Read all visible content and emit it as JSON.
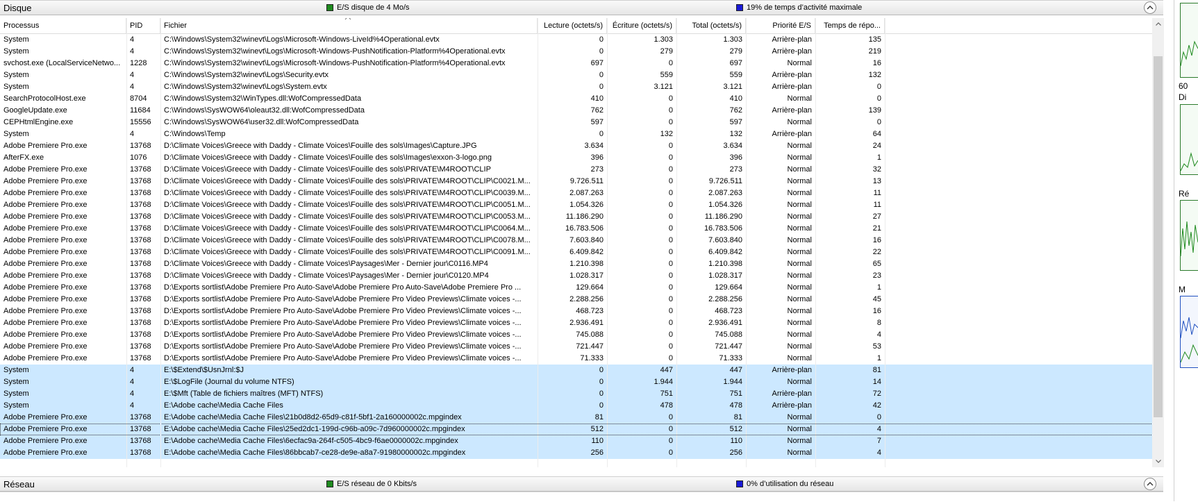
{
  "disk_section": {
    "title": "Disque",
    "stat1": "E/S disque de 4 Mo/s",
    "stat2": "19% de temps d’activité maximale"
  },
  "network_section": {
    "title": "Réseau",
    "stat1": "E/S réseau de 0 Kbits/s",
    "stat2": "0% d’utilisation du réseau"
  },
  "columns": [
    "Processus",
    "PID",
    "Fichier",
    "Lecture (octets/s)",
    "Écriture (octets/s)",
    "Total (octets/s)",
    "Priorité E/S",
    "Temps de répo..."
  ],
  "rows": [
    [
      "System",
      "4",
      "C:\\Windows\\System32\\winevt\\Logs\\Microsoft-Windows-LiveId%4Operational.evtx",
      "0",
      "1.303",
      "1.303",
      "Arrière-plan",
      "135"
    ],
    [
      "System",
      "4",
      "C:\\Windows\\System32\\winevt\\Logs\\Microsoft-Windows-PushNotification-Platform%4Operational.evtx",
      "0",
      "279",
      "279",
      "Arrière-plan",
      "219"
    ],
    [
      "svchost.exe (LocalServiceNetwo...",
      "1228",
      "C:\\Windows\\System32\\winevt\\Logs\\Microsoft-Windows-PushNotification-Platform%4Operational.evtx",
      "697",
      "0",
      "697",
      "Normal",
      "16"
    ],
    [
      "System",
      "4",
      "C:\\Windows\\System32\\winevt\\Logs\\Security.evtx",
      "0",
      "559",
      "559",
      "Arrière-plan",
      "132"
    ],
    [
      "System",
      "4",
      "C:\\Windows\\System32\\winevt\\Logs\\System.evtx",
      "0",
      "3.121",
      "3.121",
      "Arrière-plan",
      "0"
    ],
    [
      "SearchProtocolHost.exe",
      "8704",
      "C:\\Windows\\System32\\WinTypes.dll:WofCompressedData",
      "410",
      "0",
      "410",
      "Normal",
      "0"
    ],
    [
      "GoogleUpdate.exe",
      "11684",
      "C:\\Windows\\SysWOW64\\oleaut32.dll:WofCompressedData",
      "762",
      "0",
      "762",
      "Arrière-plan",
      "139"
    ],
    [
      "CEPHtmlEngine.exe",
      "15556",
      "C:\\Windows\\SysWOW64\\user32.dll:WofCompressedData",
      "597",
      "0",
      "597",
      "Normal",
      "0"
    ],
    [
      "System",
      "4",
      "C:\\Windows\\Temp",
      "0",
      "132",
      "132",
      "Arrière-plan",
      "64"
    ],
    [
      "Adobe Premiere Pro.exe",
      "13768",
      "D:\\Climate Voices\\Greece with Daddy - Climate Voices\\Fouille des sols\\Images\\Capture.JPG",
      "3.634",
      "0",
      "3.634",
      "Normal",
      "24"
    ],
    [
      "AfterFX.exe",
      "1076",
      "D:\\Climate Voices\\Greece with Daddy - Climate Voices\\Fouille des sols\\Images\\exxon-3-logo.png",
      "396",
      "0",
      "396",
      "Normal",
      "1"
    ],
    [
      "Adobe Premiere Pro.exe",
      "13768",
      "D:\\Climate Voices\\Greece with Daddy - Climate Voices\\Fouille des sols\\PRIVATE\\M4ROOT\\CLIP",
      "273",
      "0",
      "273",
      "Normal",
      "32"
    ],
    [
      "Adobe Premiere Pro.exe",
      "13768",
      "D:\\Climate Voices\\Greece with Daddy - Climate Voices\\Fouille des sols\\PRIVATE\\M4ROOT\\CLIP\\C0021.M...",
      "9.726.511",
      "0",
      "9.726.511",
      "Normal",
      "13"
    ],
    [
      "Adobe Premiere Pro.exe",
      "13768",
      "D:\\Climate Voices\\Greece with Daddy - Climate Voices\\Fouille des sols\\PRIVATE\\M4ROOT\\CLIP\\C0039.M...",
      "2.087.263",
      "0",
      "2.087.263",
      "Normal",
      "11"
    ],
    [
      "Adobe Premiere Pro.exe",
      "13768",
      "D:\\Climate Voices\\Greece with Daddy - Climate Voices\\Fouille des sols\\PRIVATE\\M4ROOT\\CLIP\\C0051.M...",
      "1.054.326",
      "0",
      "1.054.326",
      "Normal",
      "11"
    ],
    [
      "Adobe Premiere Pro.exe",
      "13768",
      "D:\\Climate Voices\\Greece with Daddy - Climate Voices\\Fouille des sols\\PRIVATE\\M4ROOT\\CLIP\\C0053.M...",
      "11.186.290",
      "0",
      "11.186.290",
      "Normal",
      "27"
    ],
    [
      "Adobe Premiere Pro.exe",
      "13768",
      "D:\\Climate Voices\\Greece with Daddy - Climate Voices\\Fouille des sols\\PRIVATE\\M4ROOT\\CLIP\\C0064.M...",
      "16.783.506",
      "0",
      "16.783.506",
      "Normal",
      "21"
    ],
    [
      "Adobe Premiere Pro.exe",
      "13768",
      "D:\\Climate Voices\\Greece with Daddy - Climate Voices\\Fouille des sols\\PRIVATE\\M4ROOT\\CLIP\\C0078.M...",
      "7.603.840",
      "0",
      "7.603.840",
      "Normal",
      "16"
    ],
    [
      "Adobe Premiere Pro.exe",
      "13768",
      "D:\\Climate Voices\\Greece with Daddy - Climate Voices\\Fouille des sols\\PRIVATE\\M4ROOT\\CLIP\\C0091.M...",
      "6.409.842",
      "0",
      "6.409.842",
      "Normal",
      "22"
    ],
    [
      "Adobe Premiere Pro.exe",
      "13768",
      "D:\\Climate Voices\\Greece with Daddy - Climate Voices\\Paysages\\Mer - Dernier jour\\C0116.MP4",
      "1.210.398",
      "0",
      "1.210.398",
      "Normal",
      "65"
    ],
    [
      "Adobe Premiere Pro.exe",
      "13768",
      "D:\\Climate Voices\\Greece with Daddy - Climate Voices\\Paysages\\Mer - Dernier jour\\C0120.MP4",
      "1.028.317",
      "0",
      "1.028.317",
      "Normal",
      "23"
    ],
    [
      "Adobe Premiere Pro.exe",
      "13768",
      "D:\\Exports sortlist\\Adobe Premiere Pro Auto-Save\\Adobe Premiere Pro Auto-Save\\Adobe Premiere Pro ...",
      "129.664",
      "0",
      "129.664",
      "Normal",
      "1"
    ],
    [
      "Adobe Premiere Pro.exe",
      "13768",
      "D:\\Exports sortlist\\Adobe Premiere Pro Auto-Save\\Adobe Premiere Pro Video Previews\\Climate voices -...",
      "2.288.256",
      "0",
      "2.288.256",
      "Normal",
      "45"
    ],
    [
      "Adobe Premiere Pro.exe",
      "13768",
      "D:\\Exports sortlist\\Adobe Premiere Pro Auto-Save\\Adobe Premiere Pro Video Previews\\Climate voices -...",
      "468.723",
      "0",
      "468.723",
      "Normal",
      "16"
    ],
    [
      "Adobe Premiere Pro.exe",
      "13768",
      "D:\\Exports sortlist\\Adobe Premiere Pro Auto-Save\\Adobe Premiere Pro Video Previews\\Climate voices -...",
      "2.936.491",
      "0",
      "2.936.491",
      "Normal",
      "8"
    ],
    [
      "Adobe Premiere Pro.exe",
      "13768",
      "D:\\Exports sortlist\\Adobe Premiere Pro Auto-Save\\Adobe Premiere Pro Video Previews\\Climate voices -...",
      "745.088",
      "0",
      "745.088",
      "Normal",
      "4"
    ],
    [
      "Adobe Premiere Pro.exe",
      "13768",
      "D:\\Exports sortlist\\Adobe Premiere Pro Auto-Save\\Adobe Premiere Pro Video Previews\\Climate voices -...",
      "721.447",
      "0",
      "721.447",
      "Normal",
      "53"
    ],
    [
      "Adobe Premiere Pro.exe",
      "13768",
      "D:\\Exports sortlist\\Adobe Premiere Pro Auto-Save\\Adobe Premiere Pro Video Previews\\Climate voices -...",
      "71.333",
      "0",
      "71.333",
      "Normal",
      "1"
    ],
    [
      "System",
      "4",
      "E:\\$Extend\\$UsnJrnl:$J",
      "0",
      "447",
      "447",
      "Arrière-plan",
      "81"
    ],
    [
      "System",
      "4",
      "E:\\$LogFile (Journal du volume NTFS)",
      "0",
      "1.944",
      "1.944",
      "Normal",
      "14"
    ],
    [
      "System",
      "4",
      "E:\\$Mft (Table de fichiers maîtres (MFT) NTFS)",
      "0",
      "751",
      "751",
      "Arrière-plan",
      "72"
    ],
    [
      "System",
      "4",
      "E:\\Adobe cache\\Media Cache Files",
      "0",
      "478",
      "478",
      "Arrière-plan",
      "42"
    ],
    [
      "Adobe Premiere Pro.exe",
      "13768",
      "E:\\Adobe cache\\Media Cache Files\\21b0d8d2-65d9-c81f-5bf1-2a160000002c.mpgindex",
      "81",
      "0",
      "81",
      "Normal",
      "0"
    ],
    [
      "Adobe Premiere Pro.exe",
      "13768",
      "E:\\Adobe cache\\Media Cache Files\\25ed2dc1-199d-c96b-a09c-7d960000002c.mpgindex",
      "512",
      "0",
      "512",
      "Normal",
      "4"
    ],
    [
      "Adobe Premiere Pro.exe",
      "13768",
      "E:\\Adobe cache\\Media Cache Files\\6ecfac9a-264f-c505-4bc9-f6ae0000002c.mpgindex",
      "110",
      "0",
      "110",
      "Normal",
      "7"
    ],
    [
      "Adobe Premiere Pro.exe",
      "13768",
      "E:\\Adobe cache\\Media Cache Files\\86bbcab7-ce28-de9e-a8a7-91980000002c.mpgindex",
      "256",
      "0",
      "256",
      "Normal",
      "4"
    ]
  ],
  "selected_from_index": 28,
  "focused_index": 33,
  "side_labels": [
    "60",
    "Di",
    "Ré",
    "M"
  ],
  "colors": {
    "selection": "#cce8ff",
    "disk_graph": "#1e8a1e",
    "network_graph": "#1a1ad6"
  }
}
